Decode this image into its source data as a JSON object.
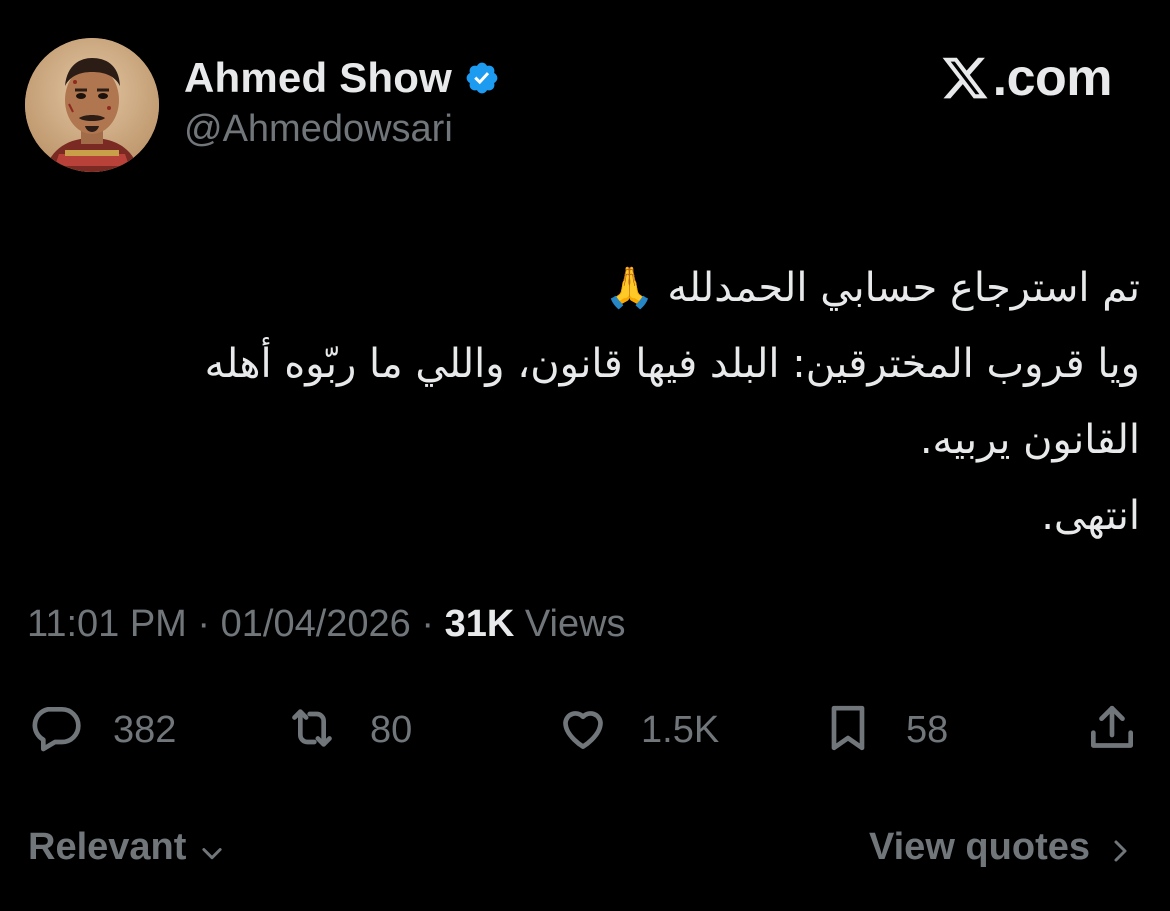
{
  "author": {
    "display_name": "Ahmed Show",
    "handle": "@Ahmedowsari",
    "verified": true
  },
  "brand": {
    "text": ".com",
    "logo_icon": "x-logo-icon"
  },
  "tweet": {
    "lines": [
      "تم استرجاع حسابي الحمدلله 🙏",
      "ويا قروب المخترقين: البلد فيها قانون، واللي ما ربّوه أهله",
      "القانون يربيه.",
      "انتهى."
    ]
  },
  "meta": {
    "time": "11:01 PM",
    "date": "01/04/2026",
    "separator": "·",
    "views_count": "31K",
    "views_label": "Views"
  },
  "actions": {
    "replies": "382",
    "reposts": "80",
    "likes": "1.5K",
    "bookmarks": "58"
  },
  "footer": {
    "sort_label": "Relevant",
    "view_quotes_label": "View quotes"
  },
  "colors": {
    "background": "#000000",
    "primary_text": "#e7e9ea",
    "secondary_text": "#71767b",
    "verified_blue": "#1d9bf0"
  }
}
